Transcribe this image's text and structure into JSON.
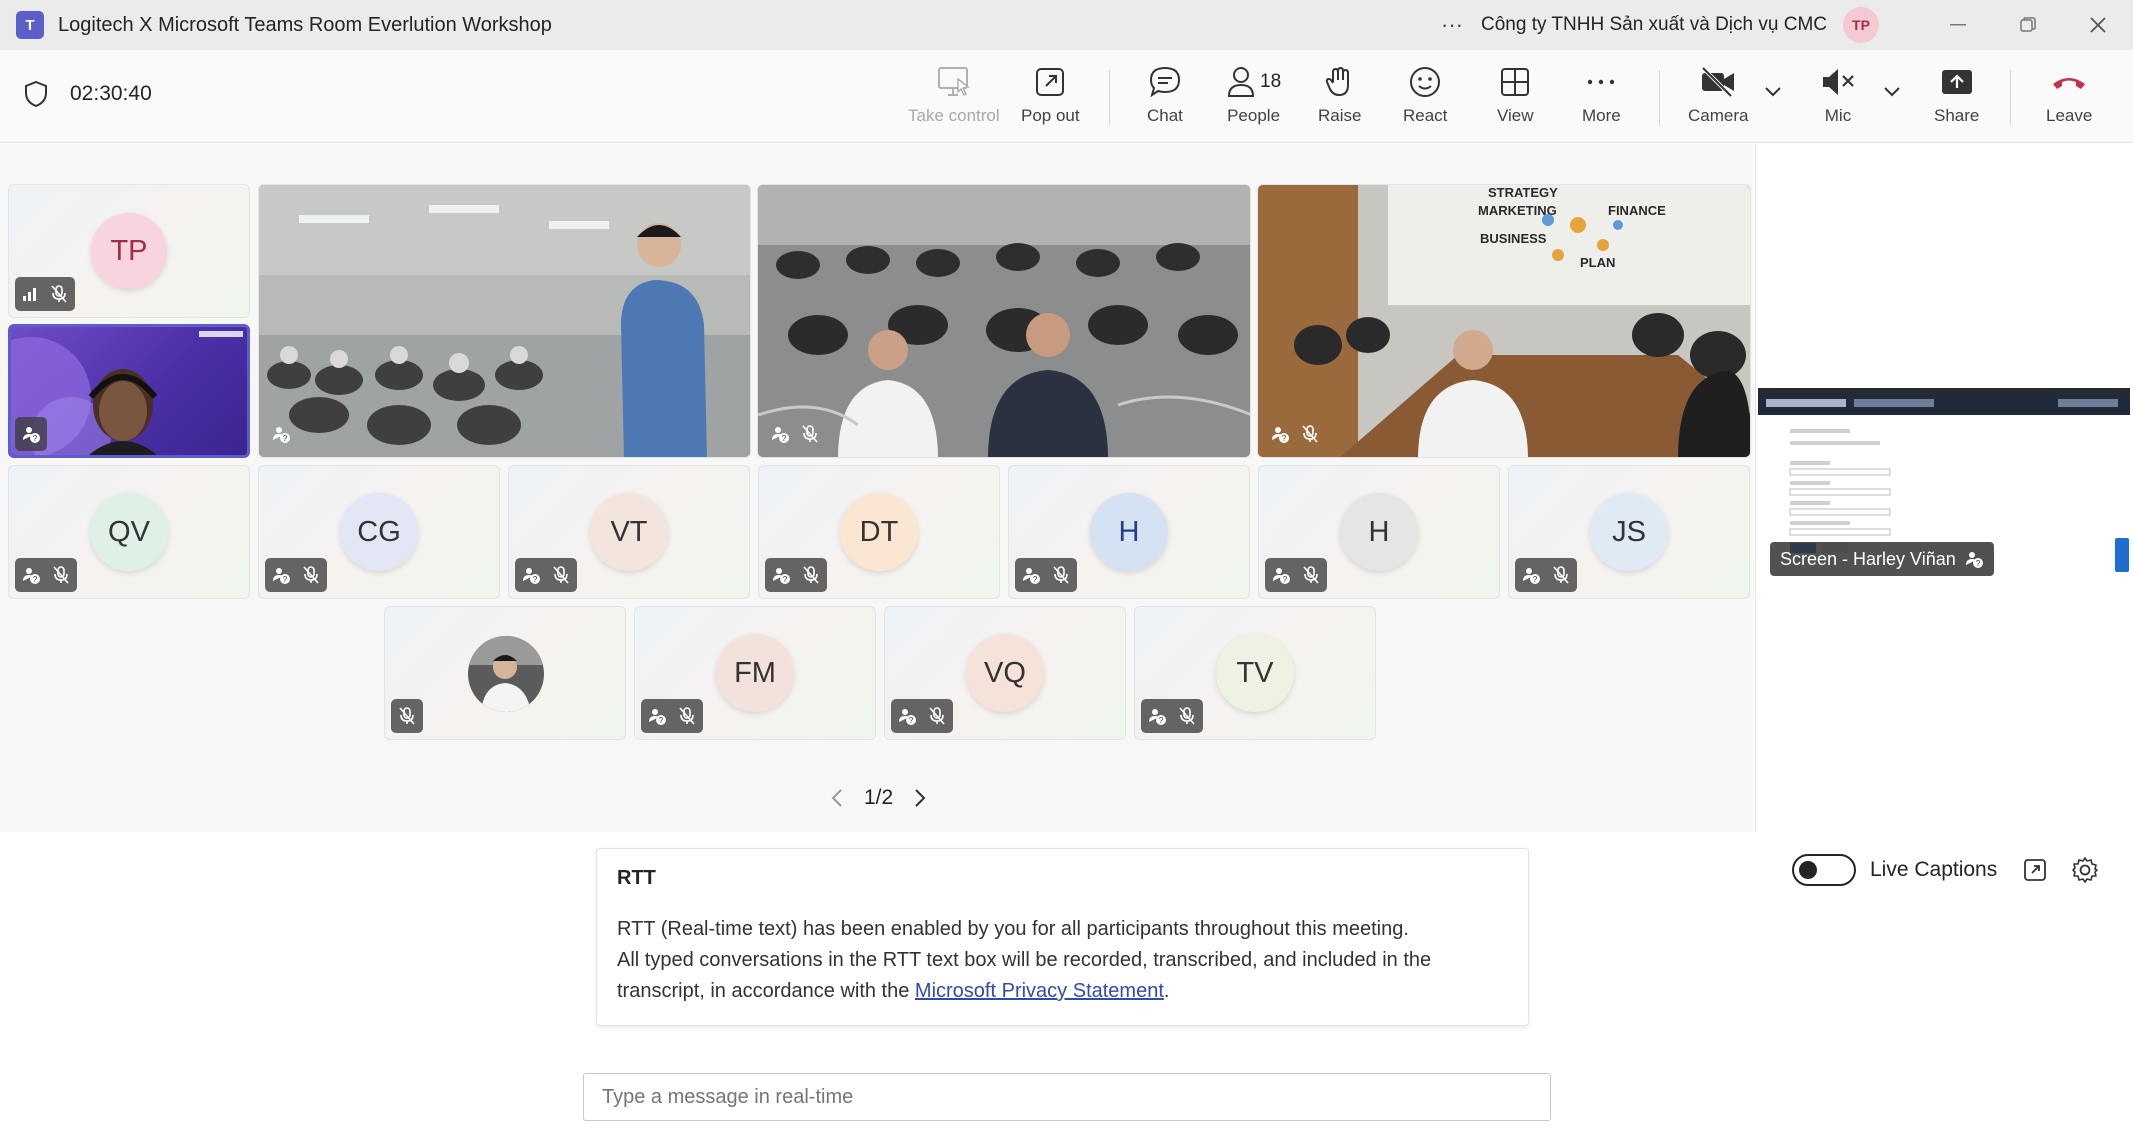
{
  "window": {
    "title": "Logitech X Microsoft Teams Room Everlution Workshop",
    "org": "Công ty TNHH Sản xuất và Dịch vụ CMC",
    "user_initials": "TP"
  },
  "toolbar": {
    "timer": "02:30:40",
    "take_control": "Take control",
    "pop_out": "Pop out",
    "chat": "Chat",
    "people": "People",
    "people_count": "18",
    "raise": "Raise",
    "react": "React",
    "view": "View",
    "more": "More",
    "camera": "Camera",
    "mic": "Mic",
    "share": "Share",
    "leave": "Leave"
  },
  "participants_row1": [
    {
      "initials": "TP",
      "color": "#f8d5de",
      "text_color": "#a02d4a"
    }
  ],
  "participants_row2": [
    {
      "initials": "QV",
      "color": "#dff0e6"
    },
    {
      "initials": "CG",
      "color": "#e3e6f5"
    },
    {
      "initials": "VT",
      "color": "#f4e4de"
    },
    {
      "initials": "DT",
      "color": "#fbe6d2"
    },
    {
      "initials": "H",
      "color": "#d4e2f4",
      "text_color": "#1f3f86"
    },
    {
      "initials": "H",
      "color": "#e5e5e5"
    },
    {
      "initials": "JS",
      "color": "#dfeaf5"
    }
  ],
  "participants_row3": [
    {
      "initials": "FM",
      "color": "#f3e2dc"
    },
    {
      "initials": "VQ",
      "color": "#f5e3da"
    },
    {
      "initials": "TV",
      "color": "#eef2e2"
    }
  ],
  "pager": {
    "label": "1/2"
  },
  "share": {
    "label": "Screen - Harley Viñan"
  },
  "room_wall": {
    "w1": "STRATEGY",
    "w2": "MARKETING",
    "w3": "BUSINESS",
    "w4": "PLAN",
    "w5": "FINANCE"
  },
  "rtt": {
    "title": "RTT",
    "body_line1": "RTT (Real-time text) has been enabled by you for all participants throughout this meeting.",
    "body_line2": "All typed conversations in the RTT text box will be recorded, transcribed, and included in the",
    "body_line3_prefix": "transcript, in accordance with the ",
    "link": "Microsoft Privacy Statement",
    "body_line3_suffix": ".",
    "placeholder": "Type a message in real-time"
  },
  "captions": {
    "label": "Live Captions"
  },
  "colors": {
    "accent": "#5b5fc7",
    "leave": "#c4314b",
    "link": "#2f4ca8"
  }
}
